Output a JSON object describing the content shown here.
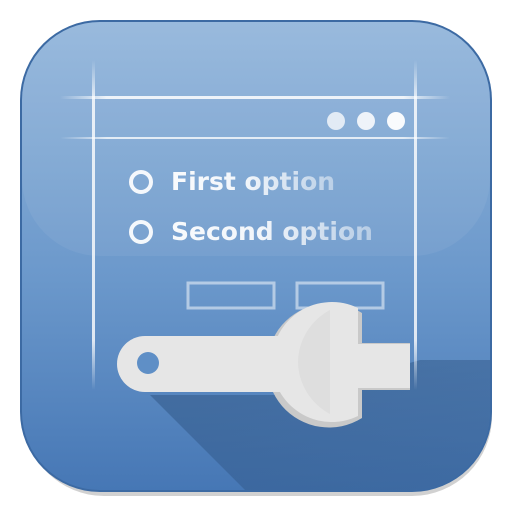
{
  "app_icon": {
    "name": "preferences-icon",
    "colors": {
      "tile_top": "#8fb3da",
      "tile_bottom": "#4a7fbc",
      "wrench": "#e6e6e6",
      "shadow": "#3f6690"
    },
    "window": {
      "dots": 3
    },
    "options": [
      {
        "label": "First option"
      },
      {
        "label": "Second option"
      }
    ]
  }
}
